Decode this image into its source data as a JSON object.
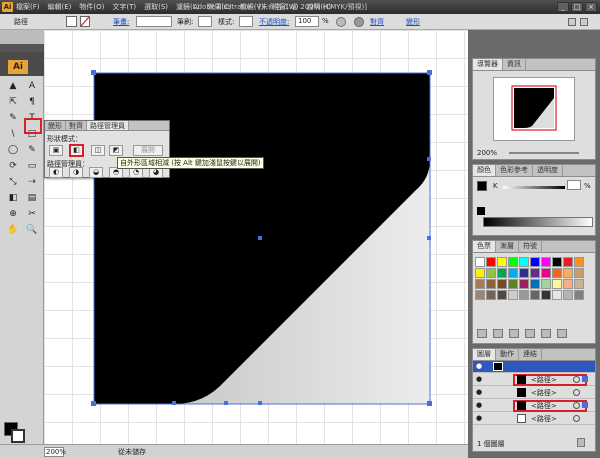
{
  "app": {
    "icon_text": "Ai",
    "window_title": "Adobe Illustrator - [未命名-1 @ 200% (CMYK/預視)]",
    "menu": [
      "檔案(F)",
      "編輯(E)",
      "物件(O)",
      "文字(T)",
      "選取(S)",
      "濾鏡(L)",
      "效果(C)",
      "檢視(V)",
      "視窗(W)",
      "說明(H)"
    ],
    "win_buttons": [
      "_",
      "□",
      "×"
    ]
  },
  "control_bar": {
    "object_type": "路徑",
    "stroke_label": "筆畫:",
    "brush_label": "筆刷:",
    "style_label": "樣式:",
    "opacity_label": "不透明度:",
    "opacity_value": "100",
    "opacity_unit": "%",
    "align_label": "對齊",
    "transform_label": "變形"
  },
  "tools": {
    "header_logo": "Ai",
    "items": [
      "▲",
      "A",
      "⇱",
      "¶",
      "✎",
      "T",
      "\\",
      "□",
      "◯",
      "✎",
      "⟳",
      "▭",
      "⤡",
      "⇢",
      "◧",
      "▤",
      "⊕",
      "✂",
      "✋",
      "🔍"
    ]
  },
  "pathfinder": {
    "tabs": [
      "變形",
      "對齊",
      "路徑管理員"
    ],
    "shape_modes_label": "形狀模式：",
    "expand_button": "展開",
    "pathfinders_label": "路徑管理員：",
    "tooltip": "自外形區域相減 (按 Alt 鍵加淺鼠按鍵以展開)"
  },
  "navigator": {
    "tabs": [
      "導覽器",
      "資訊"
    ],
    "zoom": "200%"
  },
  "color": {
    "tabs": [
      "顏色",
      "色彩參考",
      "透明度"
    ],
    "channel": "K",
    "unit": "%"
  },
  "swatches": {
    "tabs": [
      "色票",
      "漸層",
      "符號"
    ],
    "colors": [
      "#ffffff",
      "#ff0000",
      "#ffff00",
      "#00ff00",
      "#00ffff",
      "#0000ff",
      "#ff00ff",
      "#000000",
      "#ed1c24",
      "#f7941d",
      "#fff200",
      "#8dc63f",
      "#00a651",
      "#00aeef",
      "#2e3192",
      "#662d91",
      "#ec008c",
      "#f26522",
      "#fbaf5d",
      "#c69c6d",
      "#a67c52",
      "#8c6239",
      "#754c24",
      "#598527",
      "#9e1f63",
      "#0072bc",
      "#a3d39c",
      "#fff799",
      "#f9ad81",
      "#c7b299",
      "#998675",
      "#736357",
      "#534741",
      "#cccccc",
      "#999999",
      "#666666",
      "#333333",
      "#e6e6e6",
      "#b3b3b3",
      "#808080"
    ]
  },
  "layers": {
    "tabs": [
      "圖層",
      "動作",
      "連結"
    ],
    "rows": [
      "<路徑>",
      "<路徑>",
      "<路徑>",
      "<路徑>"
    ],
    "footer": "1 個圖層"
  },
  "status": {
    "zoom": "200%",
    "status_text": "從未儲存"
  },
  "colors": {
    "artwork_black": "#000000",
    "artwork_gray": "#e0e0e0",
    "selection_blue": "#4b6fd8",
    "highlight_red": "#d8202a"
  }
}
